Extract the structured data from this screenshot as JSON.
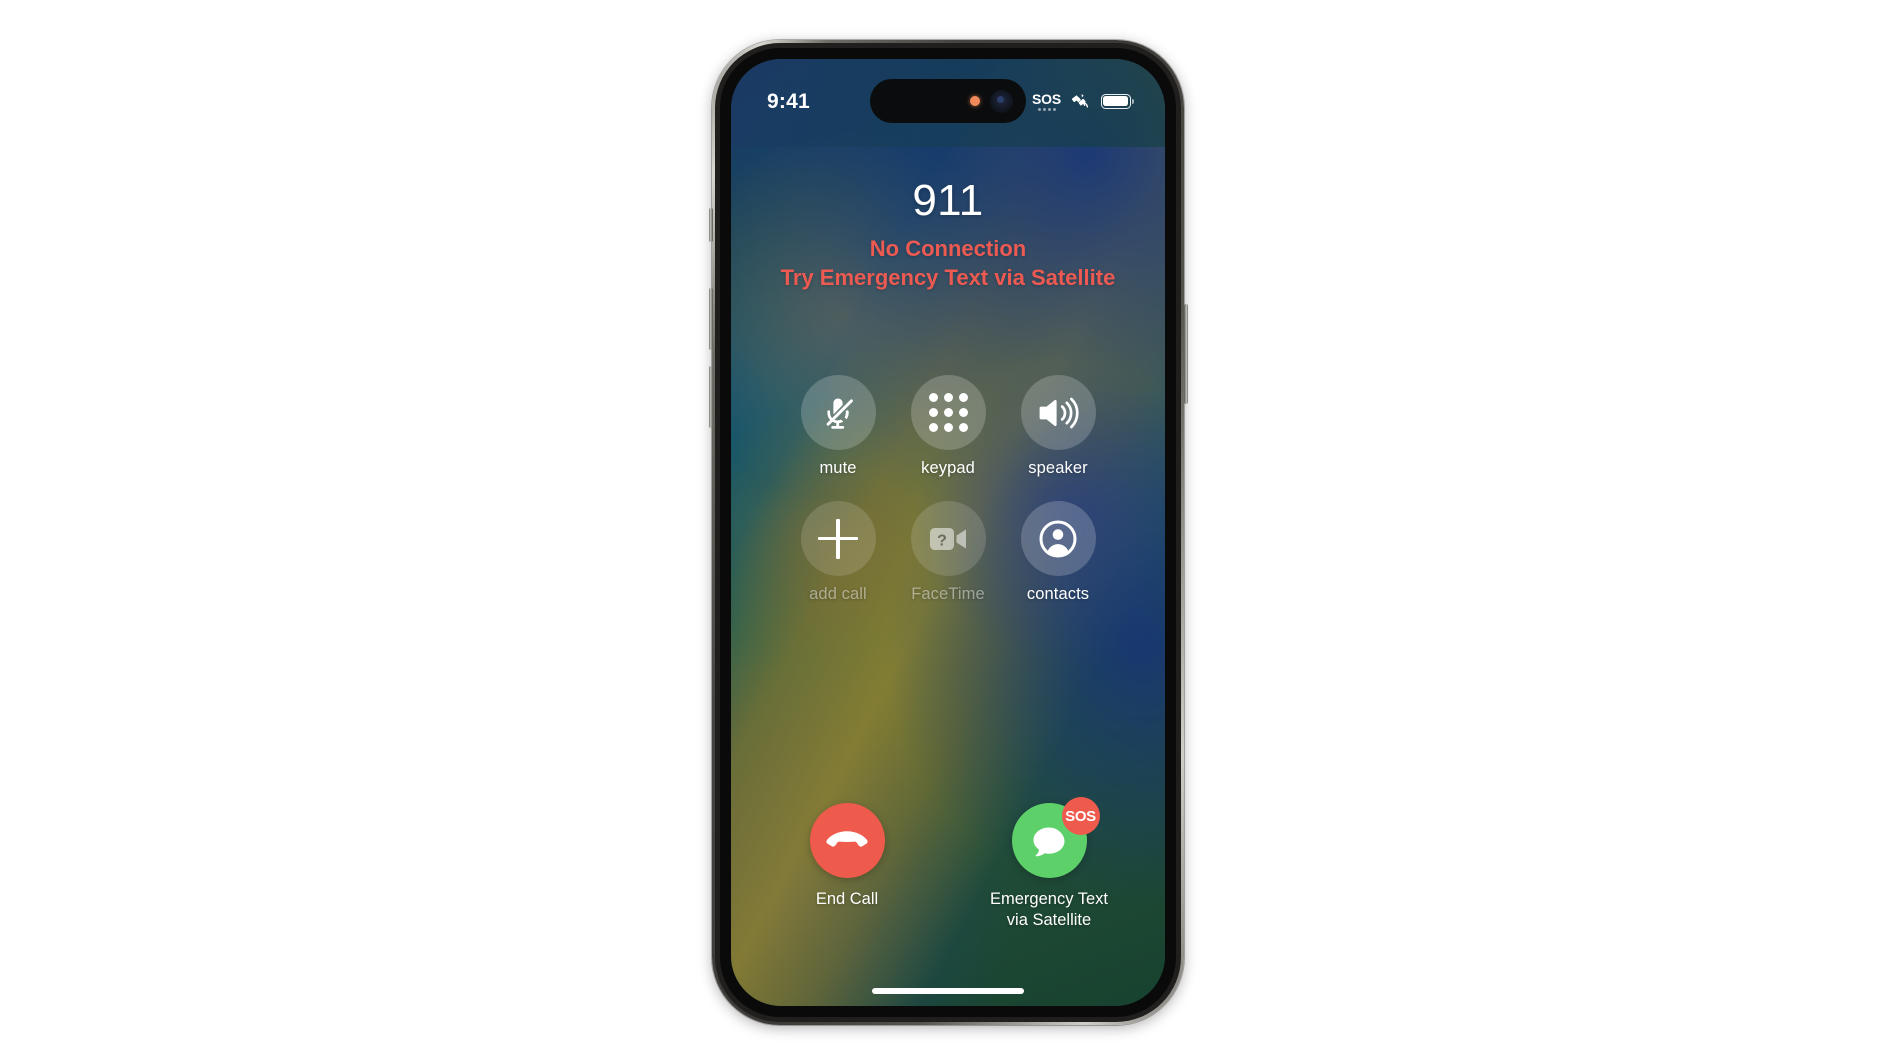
{
  "device": {
    "model_frame": "iphone-pro",
    "side_buttons": [
      "action-button",
      "volume-up-button",
      "volume-down-button",
      "power-button"
    ]
  },
  "status_bar": {
    "time": "9:41",
    "sos_label": "SOS",
    "sos_dots": 4,
    "satellite_icon": "satellite-icon",
    "battery_icon": "battery-icon",
    "battery_level_percent": 88,
    "dynamic_island": {
      "mic_indicator": "orange-mic-dot",
      "camera": "front-camera-lens"
    }
  },
  "call": {
    "callee": "911",
    "status_line1": "No Connection",
    "status_line2": "Try Emergency Text via Satellite",
    "status_color": "#ed5a52"
  },
  "controls": [
    {
      "label": "mute",
      "icon": "mic-off-icon",
      "enabled": true
    },
    {
      "label": "keypad",
      "icon": "keypad-icon",
      "enabled": true
    },
    {
      "label": "speaker",
      "icon": "speaker-icon",
      "enabled": true
    },
    {
      "label": "add call",
      "icon": "plus-icon",
      "enabled": false
    },
    {
      "label": "FaceTime",
      "icon": "facetime-unavailable-icon",
      "enabled": false
    },
    {
      "label": "contacts",
      "icon": "contacts-icon",
      "enabled": true
    }
  ],
  "bottom_actions": {
    "end_call": {
      "label": "End Call",
      "icon": "hang-up-icon",
      "color": "#ee5a4c"
    },
    "emergency_text": {
      "label_line1": "Emergency Text",
      "label_line2": "via Satellite",
      "icon": "messages-bubble-icon",
      "color": "#5ed06a",
      "badge_text": "SOS",
      "badge_color": "#ee5a4c"
    }
  },
  "home_indicator": "home-indicator"
}
